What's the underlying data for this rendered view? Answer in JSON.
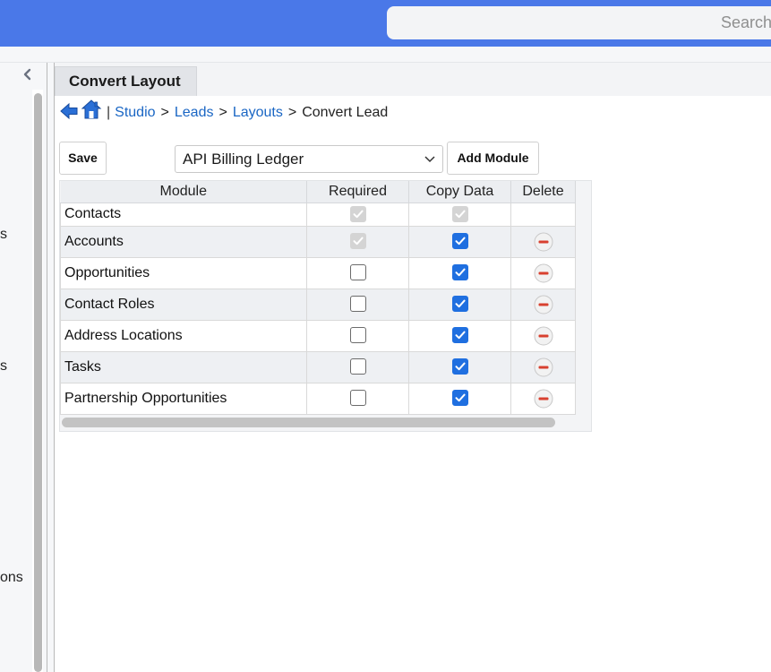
{
  "search": {
    "placeholder": "Search"
  },
  "sidebar": {
    "collapse_icon": "chevron-left-icon",
    "fragments": [
      "s",
      "s",
      "ons"
    ]
  },
  "tab": {
    "title": "Convert Layout"
  },
  "breadcrumb": {
    "back_icon": "back-arrow-icon",
    "home_icon": "home-icon",
    "separator": "|",
    "links": [
      "Studio",
      "Leads",
      "Layouts"
    ],
    "current": "Convert Lead",
    "divider": ">"
  },
  "toolbar": {
    "save_label": "Save",
    "module_select_value": "API Billing Ledger",
    "add_module_label": "Add Module"
  },
  "grid": {
    "columns": [
      "Module",
      "Required",
      "Copy Data",
      "Delete"
    ],
    "rows": [
      {
        "module": "Contacts",
        "required": "checked-disabled",
        "copy_data": "checked-disabled",
        "delete": false
      },
      {
        "module": "Accounts",
        "required": "checked-disabled",
        "copy_data": "checked",
        "delete": true
      },
      {
        "module": "Opportunities",
        "required": "unchecked",
        "copy_data": "checked",
        "delete": true
      },
      {
        "module": "Contact Roles",
        "required": "unchecked",
        "copy_data": "checked",
        "delete": true
      },
      {
        "module": "Address Locations",
        "required": "unchecked",
        "copy_data": "checked",
        "delete": true
      },
      {
        "module": "Tasks",
        "required": "unchecked",
        "copy_data": "checked",
        "delete": true
      },
      {
        "module": "Partnership Opportunities",
        "required": "unchecked",
        "copy_data": "checked",
        "delete": true
      }
    ]
  },
  "colors": {
    "topbar": "#4a78e8",
    "link": "#1a66c4",
    "checkbox_checked": "#1f6fe0",
    "delete_icon": "#d8402f"
  }
}
